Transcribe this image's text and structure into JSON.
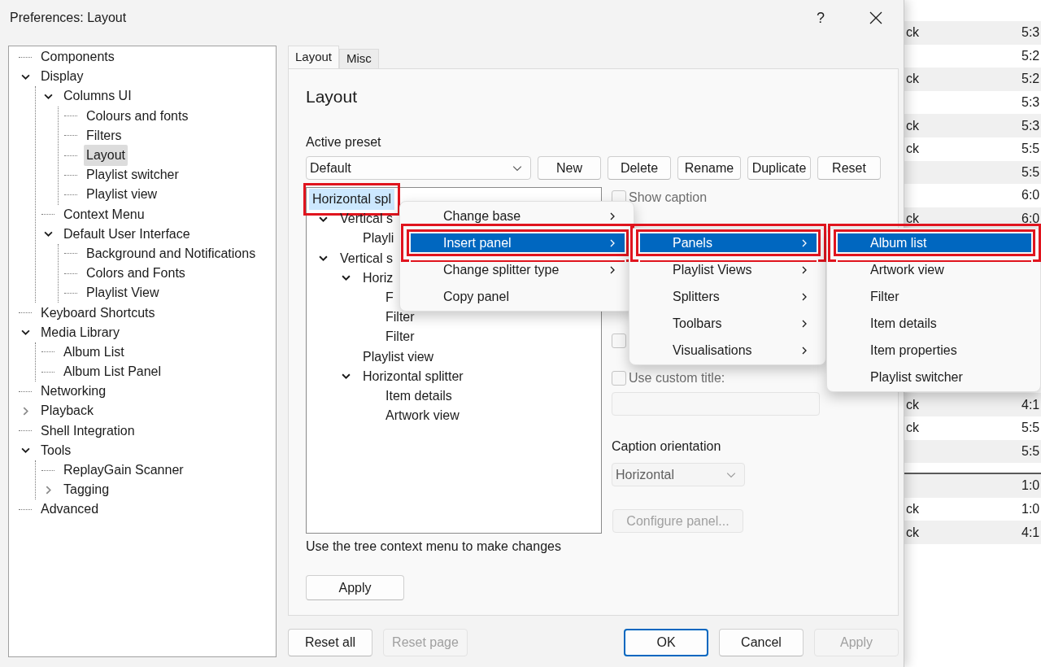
{
  "window": {
    "title": "Preferences: Layout",
    "help": "?"
  },
  "tree": {
    "items": [
      {
        "label": "Components",
        "selected": false
      },
      {
        "label": "Display",
        "selected": false,
        "expanded": true,
        "children": [
          {
            "label": "Columns UI",
            "selected": false,
            "expanded": true,
            "children": [
              {
                "label": "Colours and fonts",
                "selected": false
              },
              {
                "label": "Filters",
                "selected": false
              },
              {
                "label": "Layout",
                "selected": true
              },
              {
                "label": "Playlist switcher",
                "selected": false
              },
              {
                "label": "Playlist view",
                "selected": false
              }
            ]
          },
          {
            "label": "Context Menu",
            "selected": false
          },
          {
            "label": "Default User Interface",
            "selected": false,
            "expanded": true,
            "children": [
              {
                "label": "Background and Notifications",
                "selected": false
              },
              {
                "label": "Colors and Fonts",
                "selected": false
              },
              {
                "label": "Playlist View",
                "selected": false
              }
            ]
          }
        ]
      },
      {
        "label": "Keyboard Shortcuts",
        "selected": false
      },
      {
        "label": "Media Library",
        "selected": false,
        "expanded": true,
        "children": [
          {
            "label": "Album List",
            "selected": false
          },
          {
            "label": "Album List Panel",
            "selected": false
          }
        ]
      },
      {
        "label": "Networking",
        "selected": false
      },
      {
        "label": "Playback",
        "selected": false,
        "expanded": false
      },
      {
        "label": "Shell Integration",
        "selected": false
      },
      {
        "label": "Tools",
        "selected": false,
        "expanded": true,
        "children": [
          {
            "label": "ReplayGain Scanner",
            "selected": false
          },
          {
            "label": "Tagging",
            "selected": false,
            "expanded": false
          }
        ]
      },
      {
        "label": "Advanced",
        "selected": false
      }
    ]
  },
  "tabs": [
    {
      "label": "Layout",
      "selected": true
    },
    {
      "label": "Misc",
      "selected": false
    }
  ],
  "page": {
    "heading": "Layout",
    "preset_label": "Active preset",
    "preset": {
      "value": "Default"
    },
    "preset_buttons": [
      {
        "label": "New"
      },
      {
        "label": "Delete"
      },
      {
        "label": "Rename"
      },
      {
        "label": "Duplicate"
      },
      {
        "label": "Reset"
      }
    ],
    "layout_tree": {
      "items": [
        {
          "label": "Horizontal spl",
          "selected": true,
          "callout": true,
          "children": [
            {
              "label": "Vertical s",
              "selected": false,
              "callout": false,
              "expanded": true,
              "children": [
                {
                  "label": "Playli",
                  "selected": false,
                  "callout": false
                }
              ]
            },
            {
              "label": "Vertical s",
              "selected": false,
              "callout": false,
              "expanded": true,
              "children": [
                {
                  "label": "Horiz",
                  "selected": false,
                  "callout": false,
                  "expanded": true,
                  "children": [
                    {
                      "label": "F",
                      "selected": false,
                      "callout": false
                    },
                    {
                      "label": "Filter",
                      "selected": false,
                      "callout": false
                    },
                    {
                      "label": "Filter",
                      "selected": false,
                      "callout": false
                    }
                  ]
                },
                {
                  "label": "Playlist view",
                  "selected": false,
                  "callout": false
                },
                {
                  "label": "Horizontal splitter",
                  "selected": false,
                  "callout": false,
                  "expanded": true,
                  "children": [
                    {
                      "label": "Item details",
                      "selected": false,
                      "callout": false
                    },
                    {
                      "label": "Artwork view",
                      "selected": false,
                      "callout": false
                    }
                  ]
                }
              ]
            }
          ]
        }
      ]
    },
    "options": [
      {
        "kind": "checkbox",
        "label": "Show caption",
        "checked": false,
        "disabled": true
      },
      {
        "kind": "checkbox",
        "checked": false,
        "disabled": true
      },
      {
        "kind": "checkbox",
        "label": "Use custom title:",
        "checked": false,
        "disabled": true
      },
      {
        "kind": "field",
        "disabled": true
      },
      {
        "kind": "label",
        "label": "Caption orientation"
      },
      {
        "kind": "select",
        "value": "Horizontal",
        "disabled": true
      },
      {
        "kind": "button",
        "label": "Configure panel...",
        "disabled": true
      }
    ],
    "hint": "Use the tree context menu to make changes",
    "apply": {
      "label": "Apply"
    }
  },
  "footer_buttons": [
    {
      "label": "Reset all",
      "disabled": false,
      "default": false
    },
    {
      "label": "Reset page",
      "disabled": true,
      "default": false
    },
    {
      "label": "OK",
      "disabled": false,
      "default": true
    },
    {
      "label": "Cancel",
      "disabled": false,
      "default": false
    },
    {
      "label": "Apply",
      "disabled": true,
      "default": false
    }
  ],
  "menus": [
    {
      "items": [
        {
          "label": "Change base",
          "submenu": true,
          "selected": false,
          "callout": false
        },
        {
          "label": "Insert panel",
          "submenu": true,
          "selected": true,
          "callout": true
        },
        {
          "label": "Change splitter type",
          "submenu": true,
          "selected": false,
          "callout": false
        },
        {
          "label": "Copy panel",
          "submenu": false,
          "selected": false,
          "callout": false
        }
      ]
    },
    {
      "items": [
        {
          "label": "Panels",
          "submenu": true,
          "selected": true,
          "callout": true
        },
        {
          "label": "Playlist Views",
          "submenu": true,
          "selected": false,
          "callout": false
        },
        {
          "label": "Splitters",
          "submenu": true,
          "selected": false,
          "callout": false
        },
        {
          "label": "Toolbars",
          "submenu": true,
          "selected": false,
          "callout": false
        },
        {
          "label": "Visualisations",
          "submenu": true,
          "selected": false,
          "callout": false
        }
      ]
    },
    {
      "items": [
        {
          "label": "Album list",
          "submenu": false,
          "selected": true,
          "callout": true
        },
        {
          "label": "Artwork view",
          "submenu": false,
          "selected": false,
          "callout": false
        },
        {
          "label": "Filter",
          "submenu": false,
          "selected": false,
          "callout": false
        },
        {
          "label": "Item details",
          "submenu": false,
          "selected": false,
          "callout": false
        },
        {
          "label": "Item properties",
          "submenu": false,
          "selected": false,
          "callout": false
        },
        {
          "label": "Playlist switcher",
          "submenu": false,
          "selected": false,
          "callout": false
        }
      ]
    }
  ],
  "background_list": {
    "groups": [
      {
        "rows": [
          {
            "column_1": "ck",
            "column_2": "5:3"
          },
          {
            "column_2": "5:2"
          },
          {
            "column_1": "ck",
            "column_2": "5:2"
          },
          {
            "column_2": "5:3"
          },
          {
            "column_1": "ck",
            "column_2": "5:3"
          },
          {
            "column_1": "ck",
            "column_2": "5:5"
          },
          {
            "column_2": "5:5"
          },
          {
            "column_2": "6:0"
          },
          {
            "column_1": "ck",
            "column_2": "6:0"
          }
        ]
      },
      {
        "rows": [
          {
            "column_1": "ck",
            "column_2": "4:1"
          },
          {
            "column_1": "ck",
            "column_2": "5:5"
          },
          {
            "column_2": "5:5"
          }
        ]
      },
      {
        "rows": [
          {
            "column_2": "1:0"
          },
          {
            "column_1": "ck",
            "column_2": "1:0"
          },
          {
            "column_1": "ck",
            "column_2": "4:1"
          }
        ]
      }
    ]
  }
}
